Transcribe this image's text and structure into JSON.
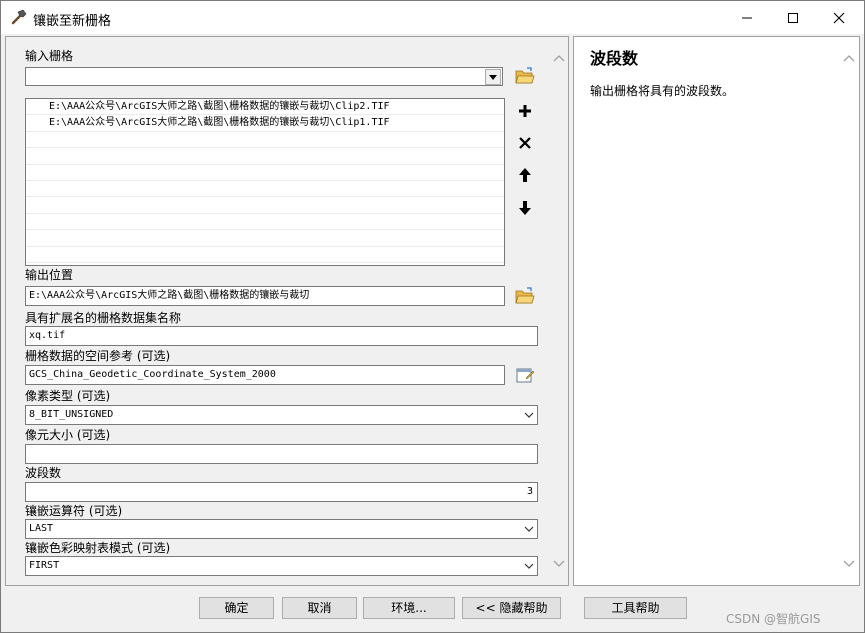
{
  "window": {
    "title": "镶嵌至新栅格"
  },
  "form": {
    "input_rasters_label": "输入栅格",
    "input_rasters_value": "",
    "input_list": [
      "E:\\AAA公众号\\ArcGIS大师之路\\截图\\栅格数据的镶嵌与裁切\\Clip2.TIF",
      "E:\\AAA公众号\\ArcGIS大师之路\\截图\\栅格数据的镶嵌与裁切\\Clip1.TIF"
    ],
    "output_location_label": "输出位置",
    "output_location_value": "E:\\AAA公众号\\ArcGIS大师之路\\截图\\栅格数据的镶嵌与裁切",
    "dataset_name_label": "具有扩展名的栅格数据集名称",
    "dataset_name_value": "xq.tif",
    "spatial_ref_label": "栅格数据的空间参考 (可选)",
    "spatial_ref_value": "GCS_China_Geodetic_Coordinate_System_2000",
    "pixel_type_label": "像素类型 (可选)",
    "pixel_type_value": "8_BIT_UNSIGNED",
    "cellsize_label": "像元大小 (可选)",
    "cellsize_value": "",
    "bands_label": "波段数",
    "bands_value": "3",
    "mosaic_operator_label": "镶嵌运算符 (可选)",
    "mosaic_operator_value": "LAST",
    "colormap_mode_label": "镶嵌色彩映射表模式 (可选)",
    "colormap_mode_value": "FIRST"
  },
  "help": {
    "title": "波段数",
    "text": "输出栅格将具有的波段数。"
  },
  "buttons": {
    "ok": "确定",
    "cancel": "取消",
    "environments": "环境...",
    "hide_help": "<< 隐藏帮助",
    "tool_help": "工具帮助"
  },
  "watermark": "CSDN @智航GIS",
  "colors": {
    "accent_folder": "#e8b84a",
    "window_bg": "#f0f0f0"
  }
}
